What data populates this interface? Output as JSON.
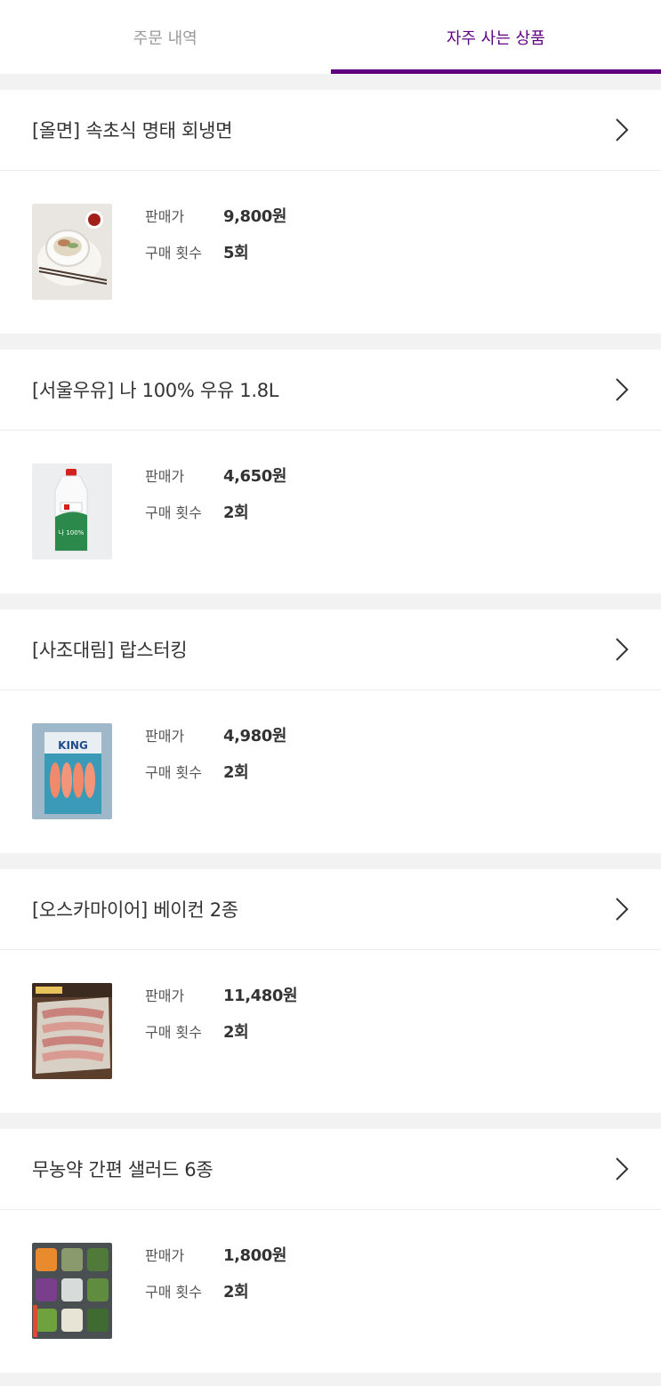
{
  "tabs": [
    {
      "label": "주문 내역",
      "active": false
    },
    {
      "label": "자주 사는 상품",
      "active": true
    }
  ],
  "labels": {
    "price": "판매가",
    "count": "구매 횟수"
  },
  "colors": {
    "accent": "#5f0080",
    "divider": "#f2f2f2"
  },
  "products": [
    {
      "name": "[올면] 속초식 명태 회냉면",
      "price": "9,800원",
      "count": "5회",
      "image": "naengmyeon-photo"
    },
    {
      "name": "[서울우유] 나 100% 우유 1.8L",
      "price": "4,650원",
      "count": "2회",
      "image": "milk-bottle-photo"
    },
    {
      "name": "[사조대림] 랍스터킹",
      "price": "4,980원",
      "count": "2회",
      "image": "lobster-king-package-photo"
    },
    {
      "name": "[오스카마이어] 베이컨 2종",
      "price": "11,480원",
      "count": "2회",
      "image": "bacon-photo"
    },
    {
      "name": "무농약 간편 샐러드 6종",
      "price": "1,800원",
      "count": "2회",
      "image": "salad-bowls-photo"
    }
  ]
}
